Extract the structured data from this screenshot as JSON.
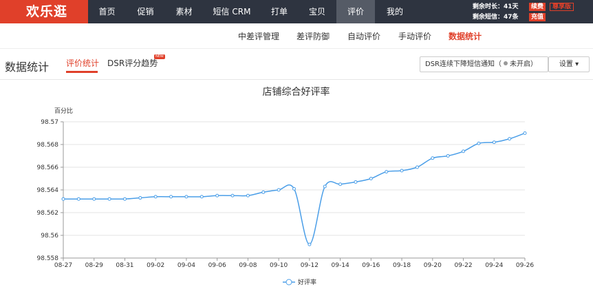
{
  "brand": {
    "logo_text": "欢乐逛",
    "accent": "#e0402a",
    "topbar_bg": "#2e3440"
  },
  "nav": {
    "items": [
      {
        "label": "首页"
      },
      {
        "label": "促销"
      },
      {
        "label": "素材"
      },
      {
        "label": "短信 CRM"
      },
      {
        "label": "打单"
      },
      {
        "label": "宝贝"
      },
      {
        "label": "评价",
        "active": true
      },
      {
        "label": "我的"
      }
    ]
  },
  "account": {
    "time_left": "剩余时长：41天",
    "renew_label": "续费",
    "sms_left": "剩余短信：47条",
    "recharge_label": "充值",
    "edition_label": "尊享版"
  },
  "subnav": {
    "items": [
      {
        "label": "中差评管理"
      },
      {
        "label": "差评防御"
      },
      {
        "label": "自动评价"
      },
      {
        "label": "手动评价"
      },
      {
        "label": "数据统计",
        "active": true
      }
    ]
  },
  "page": {
    "title": "数据统计",
    "tabs": [
      {
        "label": "评价统计",
        "active": true
      },
      {
        "label": "DSR评分趋势"
      }
    ],
    "new_badge": "NEW",
    "notify": {
      "prefix": "DSR连续下降短信通知（",
      "status": "未开启",
      "suffix": "）"
    },
    "settings_label": "设置",
    "settings_caret": "▾"
  },
  "chart_data": {
    "type": "line",
    "title": "店铺综合好评率",
    "ylabel": "百分比",
    "ylim": [
      98.558,
      98.57
    ],
    "yticks": [
      "98.558",
      "98.56",
      "98.562",
      "98.564",
      "98.566",
      "98.568",
      "98.57"
    ],
    "grid": true,
    "legend": "bottom-center",
    "xticks": [
      "08-27",
      "08-29",
      "08-31",
      "09-02",
      "09-04",
      "09-06",
      "09-08",
      "09-10",
      "09-12",
      "09-14",
      "09-16",
      "09-18",
      "09-20",
      "09-22",
      "09-24",
      "09-26"
    ],
    "series": [
      {
        "name": "好评率",
        "color": "#4a9ee8",
        "x": [
          "08-27",
          "08-28",
          "08-29",
          "08-30",
          "08-31",
          "09-01",
          "09-02",
          "09-03",
          "09-04",
          "09-05",
          "09-06",
          "09-07",
          "09-08",
          "09-09",
          "09-10",
          "09-11",
          "09-12",
          "09-13",
          "09-14",
          "09-15",
          "09-16",
          "09-17",
          "09-18",
          "09-19",
          "09-20",
          "09-21",
          "09-22",
          "09-23",
          "09-24",
          "09-25",
          "09-26"
        ],
        "values": [
          98.5632,
          98.5632,
          98.5632,
          98.5632,
          98.5632,
          98.5633,
          98.5634,
          98.5634,
          98.5634,
          98.5634,
          98.5635,
          98.5635,
          98.5635,
          98.5638,
          98.564,
          98.5641,
          98.5592,
          98.5643,
          98.5645,
          98.5647,
          98.565,
          98.5656,
          98.5657,
          98.566,
          98.5668,
          98.567,
          98.5674,
          98.5681,
          98.5682,
          98.5685,
          98.569
        ]
      }
    ]
  }
}
